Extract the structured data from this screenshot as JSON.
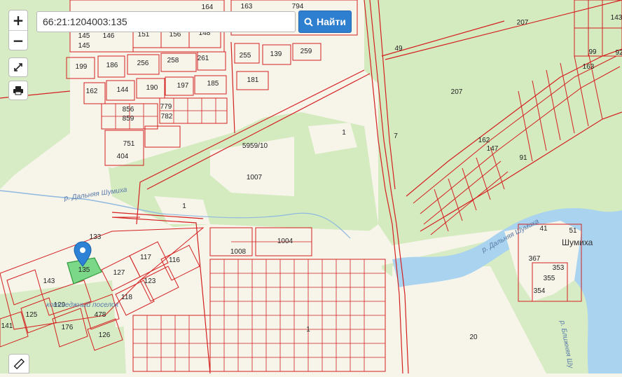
{
  "search": {
    "value": "66:21:1204003:135",
    "button_label": "Найти"
  },
  "controls": {
    "zoom_in": "+",
    "zoom_out": "−"
  },
  "map": {
    "place_name": "Шумиха",
    "river_names": [
      "р. Дальняя Шумиха",
      "р. Дальняя Шумиха",
      "р. Ближняя Шу"
    ],
    "settlement_label": "коттеджный поселок",
    "selected_parcel": "135",
    "parcel_labels": [
      "145",
      "146",
      "151",
      "156",
      "148",
      "164",
      "163",
      "794",
      "145",
      "199",
      "186",
      "256",
      "258",
      "261",
      "255",
      "139",
      "259",
      "49",
      "207",
      "207",
      "99",
      "92",
      "162",
      "144",
      "190",
      "197",
      "185",
      "181",
      "143",
      "856",
      "779",
      "859",
      "782",
      "751",
      "404",
      "5959/10",
      "1007",
      "1",
      "7",
      "1",
      "162",
      "147",
      "133",
      "1008",
      "1004",
      "41",
      "51",
      "367",
      "143",
      "127",
      "117",
      "116",
      "123",
      "118",
      "129",
      "125",
      "141",
      "176",
      "478",
      "126",
      "20",
      "354",
      "355",
      "353",
      "163",
      "91",
      "1"
    ]
  }
}
